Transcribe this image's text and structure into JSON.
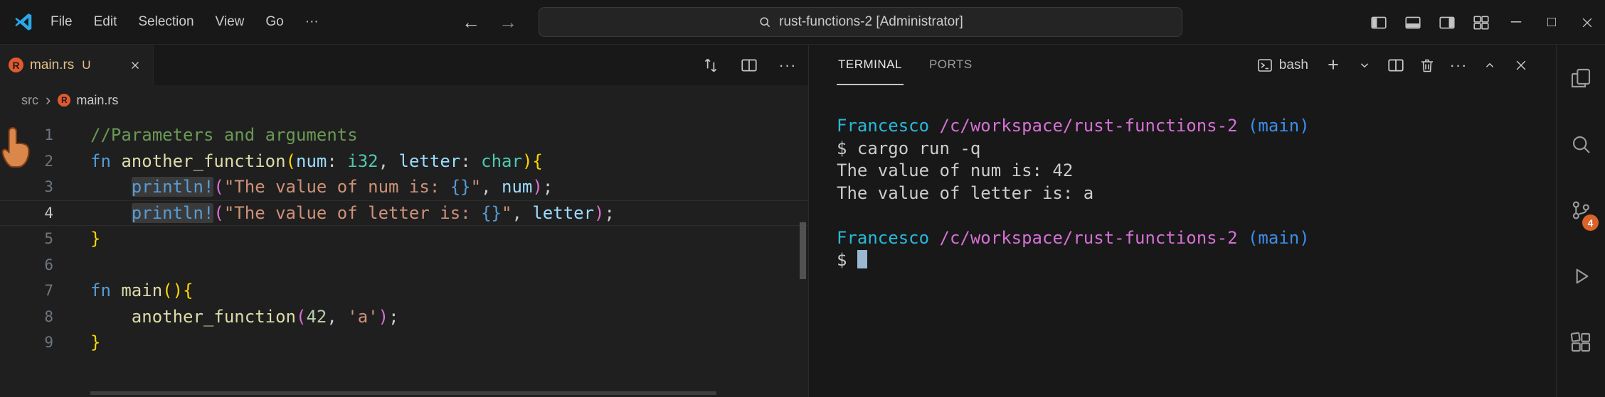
{
  "titlebar": {
    "menus": [
      "File",
      "Edit",
      "Selection",
      "View",
      "Go"
    ],
    "search_text": "rust-functions-2 [Administrator]"
  },
  "icons": {
    "back_arrow": "←",
    "forward_arrow": "→",
    "overflow": "···",
    "breadcrumb_separator": "›",
    "minimize": "─",
    "maximize": "□",
    "plus": "+",
    "rust_letter": "R"
  },
  "editor": {
    "tab": {
      "label": "main.rs",
      "git_badge": "U"
    },
    "breadcrumb": {
      "folder": "src",
      "file": "main.rs"
    },
    "code_lines": [
      {
        "n": "1",
        "tokens": [
          [
            "cmt",
            "//Parameters and arguments"
          ]
        ]
      },
      {
        "n": "2",
        "tokens": [
          [
            "kw",
            "fn "
          ],
          [
            "fnc",
            "another_function"
          ],
          [
            "b1",
            "("
          ],
          [
            "var",
            "num"
          ],
          [
            "pln",
            ": "
          ],
          [
            "typ",
            "i32"
          ],
          [
            "pln",
            ", "
          ],
          [
            "var",
            "letter"
          ],
          [
            "pln",
            ": "
          ],
          [
            "typ",
            "char"
          ],
          [
            "b1",
            ")"
          ],
          [
            "b1",
            "{"
          ]
        ]
      },
      {
        "n": "3",
        "tokens": [
          [
            "pln",
            "    "
          ],
          [
            "mac hl",
            "println!"
          ],
          [
            "b2",
            "("
          ],
          [
            "str",
            "\"The value of num is: "
          ],
          [
            "fmt",
            "{}"
          ],
          [
            "str",
            "\""
          ],
          [
            "pln",
            ", "
          ],
          [
            "var",
            "num"
          ],
          [
            "b2",
            ")"
          ],
          [
            "pln",
            ";"
          ]
        ]
      },
      {
        "n": "4",
        "current": true,
        "tokens": [
          [
            "pln",
            "    "
          ],
          [
            "mac hl",
            "println!"
          ],
          [
            "b2",
            "("
          ],
          [
            "str",
            "\"The value of letter is: "
          ],
          [
            "fmt",
            "{}"
          ],
          [
            "str",
            "\""
          ],
          [
            "pln",
            ", "
          ],
          [
            "var",
            "letter"
          ],
          [
            "b2",
            ")"
          ],
          [
            "pln",
            ";"
          ]
        ]
      },
      {
        "n": "5",
        "tokens": [
          [
            "b1",
            "}"
          ]
        ]
      },
      {
        "n": "6",
        "tokens": []
      },
      {
        "n": "7",
        "tokens": [
          [
            "kw",
            "fn "
          ],
          [
            "fnc",
            "main"
          ],
          [
            "b1",
            "("
          ],
          [
            "b1",
            ")"
          ],
          [
            "b1",
            "{"
          ]
        ]
      },
      {
        "n": "8",
        "tokens": [
          [
            "pln",
            "    "
          ],
          [
            "fnc",
            "another_function"
          ],
          [
            "b2",
            "("
          ],
          [
            "num",
            "42"
          ],
          [
            "pln",
            ", "
          ],
          [
            "str",
            "'a'"
          ],
          [
            "b2",
            ")"
          ],
          [
            "pln",
            ";"
          ]
        ]
      },
      {
        "n": "9",
        "tokens": [
          [
            "b1",
            "}"
          ]
        ]
      }
    ]
  },
  "panel": {
    "tabs": [
      {
        "label": "TERMINAL"
      },
      {
        "label": "PORTS"
      }
    ],
    "shell_label": "bash",
    "terminal_lines": [
      {
        "segments": [
          [
            "user",
            "Francesco"
          ],
          [
            "pln",
            " "
          ],
          [
            "path",
            "/c/workspace/rust-functions-2"
          ],
          [
            "pln",
            " "
          ],
          [
            "branch",
            "(main)"
          ]
        ]
      },
      {
        "segments": [
          [
            "pln",
            "$ cargo run -q"
          ]
        ]
      },
      {
        "segments": [
          [
            "pln",
            "The value of num is: 42"
          ]
        ]
      },
      {
        "segments": [
          [
            "pln",
            "The value of letter is: a"
          ]
        ]
      },
      {
        "segments": []
      },
      {
        "segments": [
          [
            "user",
            "Francesco"
          ],
          [
            "pln",
            " "
          ],
          [
            "path",
            "/c/workspace/rust-functions-2"
          ],
          [
            "pln",
            " "
          ],
          [
            "branch",
            "(main)"
          ]
        ]
      },
      {
        "segments": [
          [
            "pln",
            "$ "
          ],
          [
            "cursor",
            ""
          ]
        ]
      }
    ]
  },
  "activity_bar": {
    "scm_badge": "4"
  },
  "colors": {
    "accent_blue": "#2AA8E8",
    "badge_orange": "#d9632a",
    "rust_orange": "#e0592f",
    "tab_modified": "#e2c08d"
  }
}
